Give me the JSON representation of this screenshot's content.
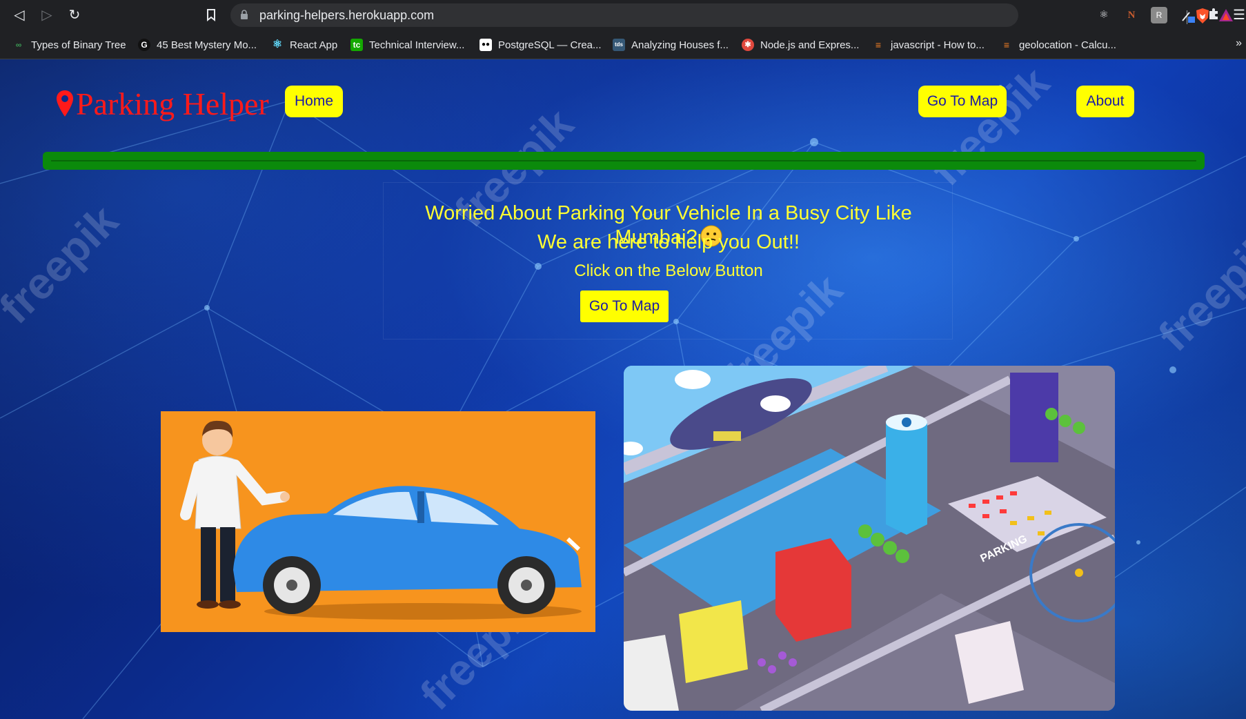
{
  "browser": {
    "url": "parking-helpers.herokuapp.com",
    "bookmarks": [
      {
        "label": "Types of Binary Tree",
        "icon": "binary-tree-favicon"
      },
      {
        "label": "45 Best Mystery Mo...",
        "icon": "mystery-favicon"
      },
      {
        "label": "React App",
        "icon": "react-favicon"
      },
      {
        "label": "Technical Interview...",
        "icon": "tc-favicon"
      },
      {
        "label": "PostgreSQL — Crea...",
        "icon": "medium-favicon"
      },
      {
        "label": "Analyzing Houses f...",
        "icon": "tds-favicon"
      },
      {
        "label": "Node.js and Expres...",
        "icon": "node-favicon"
      },
      {
        "label": "javascript - How to...",
        "icon": "stackoverflow-favicon"
      },
      {
        "label": "geolocation - Calcu...",
        "icon": "stackoverflow-favicon"
      }
    ],
    "more": "»",
    "bookmark_fav_text": {
      "tc": "tc",
      "tds": "tds"
    }
  },
  "header": {
    "brand": "Parking Helper",
    "nav": {
      "home": "Home",
      "map": "Go To Map",
      "about": "About"
    }
  },
  "hero": {
    "line1": "Worried About Parking Your Vehicle In a Busy City Like Mumbai?",
    "line2": "We are here to help you Out!!",
    "line3": "Click on the Below Button",
    "button": "Go To Map"
  },
  "watermark_text": "freepik",
  "city_sign": "PARKING",
  "colors": {
    "accent_yellow": "#ffff00",
    "brand_red": "#ff1a1a",
    "divider_green": "#0b8a0b",
    "button_text": "#1a1aa6"
  }
}
